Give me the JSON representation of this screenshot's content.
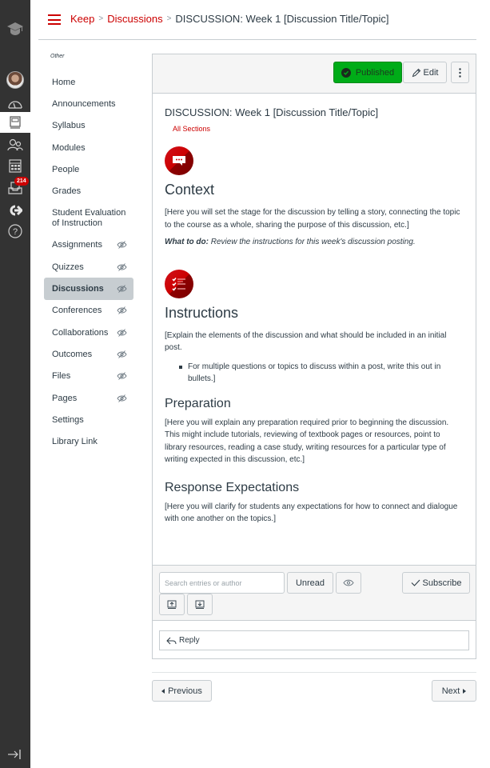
{
  "global_nav": {
    "items": [
      {
        "name": "logo",
        "icon": "graduation-cap-icon"
      },
      {
        "name": "account",
        "icon": "avatar"
      },
      {
        "name": "dashboard",
        "icon": "speedometer-icon"
      },
      {
        "name": "courses",
        "icon": "book-icon",
        "active": true
      },
      {
        "name": "groups",
        "icon": "people-icon"
      },
      {
        "name": "calendar",
        "icon": "calendar-icon"
      },
      {
        "name": "inbox",
        "icon": "inbox-icon",
        "badge": "214"
      },
      {
        "name": "commons",
        "icon": "share-arrow-icon"
      },
      {
        "name": "help",
        "icon": "help-icon"
      }
    ],
    "collapse_icon": "collapse-arrow-icon"
  },
  "header": {
    "breadcrumb": [
      {
        "label": "Keep",
        "link": true
      },
      {
        "label": "Discussions",
        "link": true
      },
      {
        "label": "DISCUSSION: Week 1 [Discussion Title/Topic]",
        "link": false
      }
    ],
    "accent_color": "#cc0000"
  },
  "course_nav": {
    "heading": "Other",
    "items": [
      {
        "label": "Home",
        "hidden": false
      },
      {
        "label": "Announcements",
        "hidden": false
      },
      {
        "label": "Syllabus",
        "hidden": false
      },
      {
        "label": "Modules",
        "hidden": false
      },
      {
        "label": "People",
        "hidden": false
      },
      {
        "label": "Grades",
        "hidden": false
      },
      {
        "label": "Student Evaluation of Instruction",
        "hidden": false
      },
      {
        "label": "Assignments",
        "hidden": true
      },
      {
        "label": "Quizzes",
        "hidden": true
      },
      {
        "label": "Discussions",
        "hidden": true,
        "active": true
      },
      {
        "label": "Conferences",
        "hidden": true
      },
      {
        "label": "Collaborations",
        "hidden": true
      },
      {
        "label": "Outcomes",
        "hidden": true
      },
      {
        "label": "Files",
        "hidden": true
      },
      {
        "label": "Pages",
        "hidden": true
      },
      {
        "label": "Settings",
        "hidden": false
      },
      {
        "label": "Library Link",
        "hidden": false
      }
    ]
  },
  "toolbar": {
    "published_label": "Published",
    "published_color": "#00ac18",
    "edit_label": "Edit",
    "more_label": "⋮"
  },
  "discussion": {
    "title": "DISCUSSION: Week 1 [Discussion Title/Topic]",
    "sections_label": "All Sections",
    "context": {
      "icon": "chat-bubble-icon",
      "heading": "Context",
      "body": "[Here you will set the stage for the discussion by telling a story, connecting the topic to the course as a whole, sharing the purpose of this discussion, etc.]",
      "what_to_do_label": "What to do:",
      "what_to_do_text": " Review the instructions for this week's discussion posting."
    },
    "instructions": {
      "icon": "checklist-icon",
      "heading": "Instructions",
      "body": "[Explain the elements of the discussion and what should be included in an initial post.",
      "bullets": [
        "For multiple questions or topics to discuss within a post, write this out in bullets.]"
      ]
    },
    "preparation": {
      "heading": "Preparation",
      "body": "[Here you will explain any preparation required prior to beginning the discussion. This might include tutorials, reviewing of textbook pages or resources, point to library resources, reading a case study, writing resources for a particular type of writing expected in this discussion, etc.]"
    },
    "response": {
      "heading": "Response Expectations",
      "body": "[Here you will clarify for students any expectations for how to connect and dialogue with one another on the topics.]"
    }
  },
  "actions": {
    "search_placeholder": "Search entries or author",
    "search_value": "",
    "unread_label": "Unread",
    "subscribe_label": "Subscribe",
    "reply_label": "Reply"
  },
  "pagination": {
    "previous_label": "Previous",
    "next_label": "Next"
  }
}
